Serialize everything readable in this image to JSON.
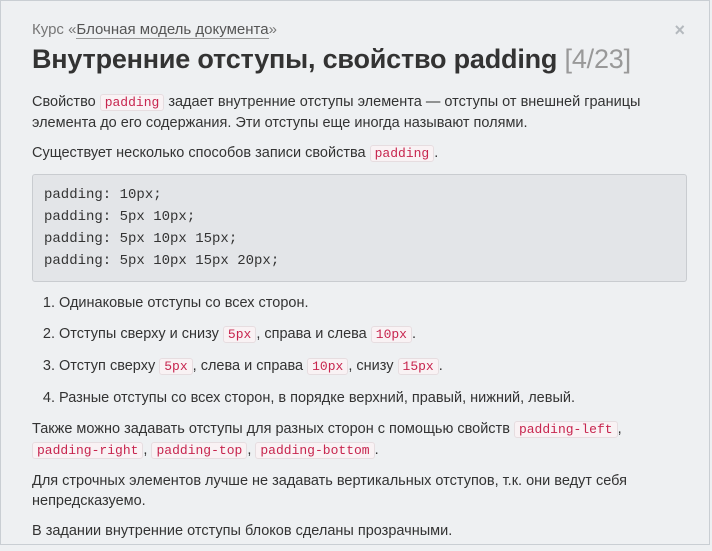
{
  "breadcrumb": {
    "prefix": "Курс «",
    "course": "Блочная модель документа",
    "suffix": "»"
  },
  "close_label": "×",
  "title": "Внутренние отступы, свойство padding",
  "progress": "[4/23]",
  "p1": {
    "t1": "Свойство ",
    "code": "padding",
    "t2": " задает внутренние отступы элемента — отступы от внешней границы элемента до его содержания. Эти отступы еще иногда называют полями."
  },
  "p2": {
    "t1": "Существует несколько способов записи свойства ",
    "code": "padding",
    "t2": "."
  },
  "code_lines": [
    "padding: 10px;",
    "padding: 5px 10px;",
    "padding: 5px 10px 15px;",
    "padding: 5px 10px 15px 20px;"
  ],
  "list": {
    "i1": "Одинаковые отступы со всех сторон.",
    "i2": {
      "t1": "Отступы сверху и снизу ",
      "c1": "5px",
      "t2": ", справа и слева ",
      "c2": "10px",
      "t3": "."
    },
    "i3": {
      "t1": "Отступ сверху ",
      "c1": "5px",
      "t2": ", слева и справа ",
      "c2": "10px",
      "t3": ", снизу ",
      "c3": "15px",
      "t4": "."
    },
    "i4": "Разные отступы со всех сторон, в порядке верхний, правый, нижний, левый."
  },
  "p3": {
    "t1": "Также можно задавать отступы для разных сторон с помощью свойств ",
    "c1": "padding-left",
    "s1": ", ",
    "c2": "padding-right",
    "s2": ", ",
    "c3": "padding-top",
    "s3": ", ",
    "c4": "padding-bottom",
    "s4": "."
  },
  "p4": "Для строчных элементов лучше не задавать вертикальных отступов, т.к. они ведут себя непредсказуемо.",
  "p5": "В задании внутренние отступы блоков сделаны прозрачными."
}
